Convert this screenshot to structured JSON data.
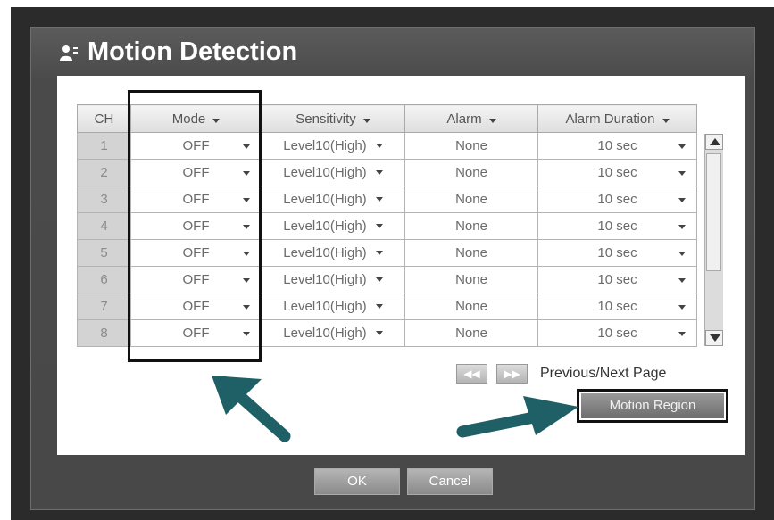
{
  "dialog": {
    "title": "Motion Detection",
    "icon": "person-icon"
  },
  "columns": {
    "ch": "CH",
    "mode": "Mode",
    "sensitivity": "Sensitivity",
    "alarm": "Alarm",
    "alarm_duration": "Alarm Duration"
  },
  "rows": [
    {
      "ch": "1",
      "mode": "OFF",
      "sensitivity": "Level10(High)",
      "alarm": "None",
      "duration": "10 sec"
    },
    {
      "ch": "2",
      "mode": "OFF",
      "sensitivity": "Level10(High)",
      "alarm": "None",
      "duration": "10 sec"
    },
    {
      "ch": "3",
      "mode": "OFF",
      "sensitivity": "Level10(High)",
      "alarm": "None",
      "duration": "10 sec"
    },
    {
      "ch": "4",
      "mode": "OFF",
      "sensitivity": "Level10(High)",
      "alarm": "None",
      "duration": "10 sec"
    },
    {
      "ch": "5",
      "mode": "OFF",
      "sensitivity": "Level10(High)",
      "alarm": "None",
      "duration": "10 sec"
    },
    {
      "ch": "6",
      "mode": "OFF",
      "sensitivity": "Level10(High)",
      "alarm": "None",
      "duration": "10 sec"
    },
    {
      "ch": "7",
      "mode": "OFF",
      "sensitivity": "Level10(High)",
      "alarm": "None",
      "duration": "10 sec"
    },
    {
      "ch": "8",
      "mode": "OFF",
      "sensitivity": "Level10(High)",
      "alarm": "None",
      "duration": "10 sec"
    }
  ],
  "pager": {
    "prev": "◀◀",
    "next": "▶▶",
    "label": "Previous/Next Page"
  },
  "buttons": {
    "motion_region": "Motion Region",
    "ok": "OK",
    "cancel": "Cancel"
  },
  "colors": {
    "arrow": "#1f5f66",
    "highlight_border": "#111111"
  }
}
